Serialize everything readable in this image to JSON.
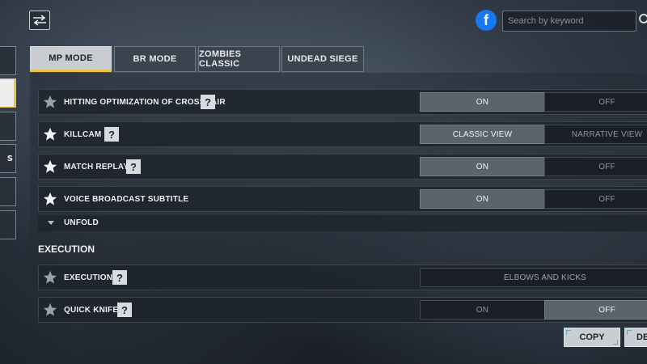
{
  "header": {
    "filter_icon": "swap-arrows-icon",
    "social_icon": "facebook-icon",
    "social_letter": "f",
    "search": {
      "placeholder": "Search by keyword",
      "value": ""
    }
  },
  "sidebar": {
    "tabs": [
      {
        "label": ""
      },
      {
        "label": "",
        "active": true
      },
      {
        "label": ""
      },
      {
        "label": "S"
      },
      {
        "label": ""
      },
      {
        "label": ""
      }
    ]
  },
  "mode_tabs": [
    {
      "label": "MP MODE",
      "active": true
    },
    {
      "label": "BR MODE"
    },
    {
      "label": "ZOMBIES CLASSIC"
    },
    {
      "label": "UNDEAD SIEGE"
    }
  ],
  "settings": [
    {
      "label": "HITTING OPTIMIZATION OF CROSSHAIR",
      "starred": false,
      "help": "?",
      "options": [
        "ON",
        "OFF"
      ],
      "selected": 0
    },
    {
      "label": "KILLCAM",
      "starred": true,
      "help": "?",
      "options": [
        "CLASSIC VIEW",
        "NARRATIVE VIEW"
      ],
      "selected": 0
    },
    {
      "label": "MATCH REPLAY",
      "starred": true,
      "help": "?",
      "options": [
        "ON",
        "OFF"
      ],
      "selected": 0
    },
    {
      "label": "VOICE BROADCAST SUBTITLE",
      "starred": true,
      "help": "",
      "options": [
        "ON",
        "OFF"
      ],
      "selected": 0
    }
  ],
  "unfold": {
    "label": "UNFOLD"
  },
  "execution_section": {
    "title": "EXECUTION",
    "rows": [
      {
        "label": "EXECUTION",
        "starred": false,
        "help": "?",
        "value": "ELBOWS AND KICKS"
      },
      {
        "label": "QUICK KNIFE",
        "starred": false,
        "help": "?",
        "options": [
          "ON",
          "OFF"
        ],
        "selected": 1
      }
    ]
  },
  "footer": {
    "copy_label": "COPY",
    "second_label": "DE"
  },
  "colors": {
    "accent": "#e9c34a",
    "selected_segment": "#5b636d",
    "facebook": "#1877f2"
  }
}
